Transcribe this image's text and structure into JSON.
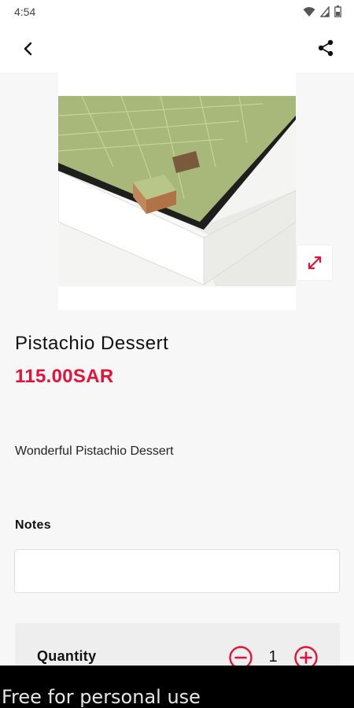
{
  "status_bar": {
    "time": "4:54",
    "icons": [
      "wifi-icon",
      "signal-icon",
      "battery-icon"
    ]
  },
  "app_bar": {
    "back_icon": "back-arrow-icon",
    "share_icon": "share-icon"
  },
  "product": {
    "image_alt": "Pistachio Dessert",
    "title": "Pistachio Dessert",
    "price": "115.00SAR",
    "description": "Wonderful Pistachio Dessert",
    "expand_icon": "expand-icon"
  },
  "notes": {
    "label": "Notes",
    "value": "",
    "placeholder": ""
  },
  "quantity": {
    "label": "Quantity",
    "value": "1",
    "minus_icon": "minus-circle-icon",
    "plus_icon": "plus-circle-icon"
  },
  "watermark": {
    "text": "Free for personal use"
  },
  "colors": {
    "accent": "#e31337",
    "background": "#f7f7f7",
    "card": "#eeeeee"
  }
}
